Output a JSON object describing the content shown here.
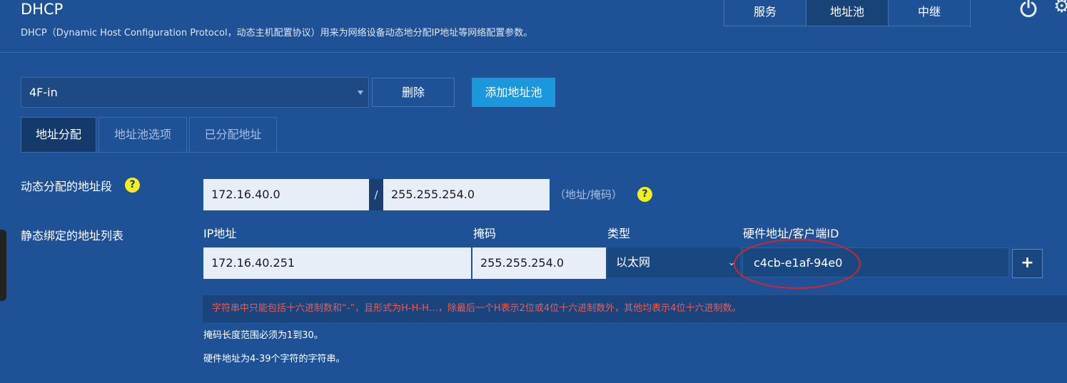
{
  "page": {
    "title": "DHCP",
    "description": "DHCP（Dynamic Host Configuration Protocol，动态主机配置协议）用来为网络设备动态地分配IP地址等网络配置参数。"
  },
  "top_tabs": [
    {
      "label": "服务"
    },
    {
      "label": "地址池"
    },
    {
      "label": "中继"
    }
  ],
  "pool": {
    "selected": "4F-in",
    "delete_label": "删除",
    "add_label": "添加地址池"
  },
  "sub_tabs": [
    {
      "label": "地址分配"
    },
    {
      "label": "地址池选项"
    },
    {
      "label": "已分配地址"
    }
  ],
  "dynamic": {
    "label": "动态分配的地址段",
    "address": "172.16.40.0",
    "separator": "/",
    "mask": "255.255.254.0",
    "hint": "（地址/掩码）"
  },
  "static": {
    "label": "静态绑定的地址列表",
    "headers": {
      "ip": "IP地址",
      "mask": "掩码",
      "type": "类型",
      "hw": "硬件地址/客户端ID"
    },
    "row": {
      "ip": "172.16.40.251",
      "mask": "255.255.254.0",
      "type": "以太网",
      "hw": "c4cb-e1af-94e0"
    },
    "add_button": "+"
  },
  "messages": {
    "error": "字符串中只能包括十六进制数和“-”，且形式为H-H-H…，除最后一个H表示2位或4位十六进制数外，其他均表示4位十六进制数。",
    "mask_note": "掩码长度范围必须为1到30。",
    "hw_note": "硬件地址为4-39个字符的字符串。"
  },
  "help_glyph": "?",
  "colors": {
    "background": "#1e5196",
    "accent_button": "#1b97dc",
    "error_text": "#ef5a52",
    "help_badge": "#f3ef1c",
    "annotation_circle": "#d8232a"
  },
  "icons": {
    "power": "power-icon",
    "settings": "gear-icon",
    "dropdown": "caret-down-icon"
  }
}
